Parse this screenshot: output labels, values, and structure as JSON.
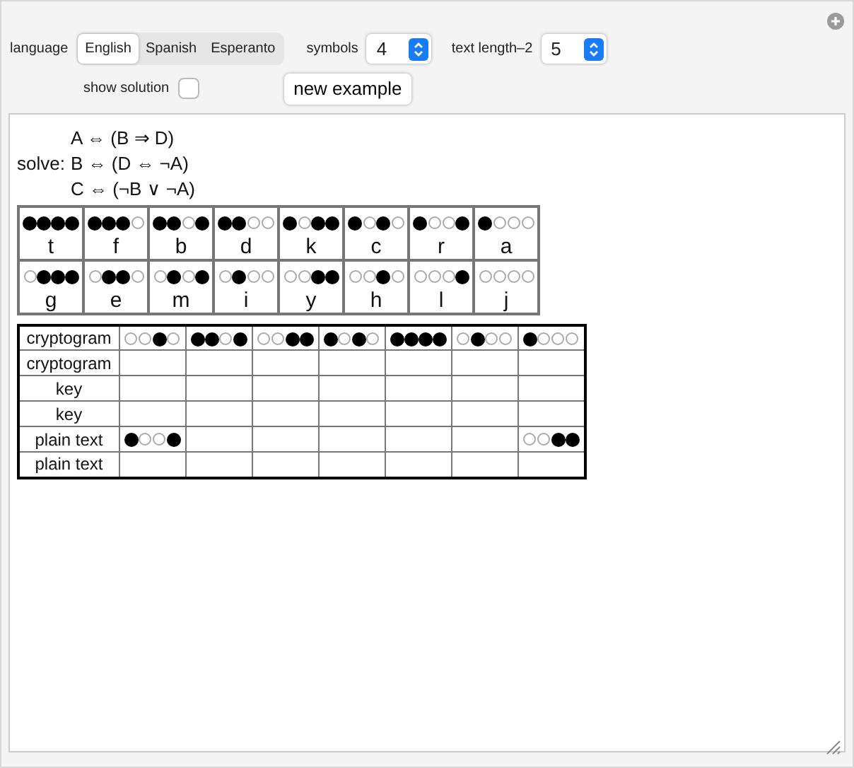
{
  "controls": {
    "language": {
      "label": "language",
      "options": [
        {
          "label": "English",
          "selected": true
        },
        {
          "label": "Spanish",
          "selected": false
        },
        {
          "label": "Esperanto",
          "selected": false
        }
      ]
    },
    "symbols": {
      "label": "symbols",
      "value": "4"
    },
    "text_length": {
      "label": "text length–2",
      "value": "5"
    },
    "show_solution": {
      "label": "show solution",
      "checked": false
    },
    "new_example": "new example"
  },
  "equations": {
    "prefix": "solve:",
    "lines": [
      "A ⇔ (B ⇒ D)",
      "B ⇔ (D ⇔ ¬A)",
      "C ⇔ (¬B ∨ ¬A)"
    ]
  },
  "legend": {
    "rows": [
      [
        {
          "letter": "t",
          "dots": [
            true,
            true,
            true,
            true
          ]
        },
        {
          "letter": "f",
          "dots": [
            true,
            true,
            true,
            false
          ]
        },
        {
          "letter": "b",
          "dots": [
            true,
            true,
            false,
            true
          ]
        },
        {
          "letter": "d",
          "dots": [
            true,
            true,
            false,
            false
          ]
        },
        {
          "letter": "k",
          "dots": [
            true,
            false,
            true,
            true
          ]
        },
        {
          "letter": "c",
          "dots": [
            true,
            false,
            true,
            false
          ]
        },
        {
          "letter": "r",
          "dots": [
            true,
            false,
            false,
            true
          ]
        },
        {
          "letter": "a",
          "dots": [
            true,
            false,
            false,
            false
          ]
        }
      ],
      [
        {
          "letter": "g",
          "dots": [
            false,
            true,
            true,
            true
          ]
        },
        {
          "letter": "e",
          "dots": [
            false,
            true,
            true,
            false
          ]
        },
        {
          "letter": "m",
          "dots": [
            false,
            true,
            false,
            true
          ]
        },
        {
          "letter": "i",
          "dots": [
            false,
            true,
            false,
            false
          ]
        },
        {
          "letter": "y",
          "dots": [
            false,
            false,
            true,
            true
          ]
        },
        {
          "letter": "h",
          "dots": [
            false,
            false,
            true,
            false
          ]
        },
        {
          "letter": "l",
          "dots": [
            false,
            false,
            false,
            true
          ]
        },
        {
          "letter": "j",
          "dots": [
            false,
            false,
            false,
            false
          ]
        }
      ]
    ]
  },
  "table": {
    "rows": [
      {
        "label": "cryptogram",
        "cells": [
          {
            "dots": [
              false,
              false,
              true,
              false
            ]
          },
          {
            "dots": [
              true,
              true,
              false,
              true
            ]
          },
          {
            "dots": [
              false,
              false,
              true,
              true
            ]
          },
          {
            "dots": [
              true,
              false,
              true,
              false
            ]
          },
          {
            "dots": [
              true,
              true,
              true,
              true
            ]
          },
          {
            "dots": [
              false,
              true,
              false,
              false
            ]
          },
          {
            "dots": [
              true,
              false,
              false,
              false
            ]
          }
        ]
      },
      {
        "label": "cryptogram",
        "cells": [
          null,
          null,
          null,
          null,
          null,
          null,
          null
        ]
      },
      {
        "label": "key",
        "cells": [
          null,
          null,
          null,
          null,
          null,
          null,
          null
        ]
      },
      {
        "label": "key",
        "cells": [
          null,
          null,
          null,
          null,
          null,
          null,
          null
        ]
      },
      {
        "label": "plain text",
        "cells": [
          {
            "dots": [
              true,
              false,
              false,
              true
            ]
          },
          null,
          null,
          null,
          null,
          null,
          {
            "dots": [
              false,
              false,
              true,
              true
            ]
          }
        ]
      },
      {
        "label": "plain text",
        "cells": [
          null,
          null,
          null,
          null,
          null,
          null,
          null
        ]
      }
    ]
  }
}
